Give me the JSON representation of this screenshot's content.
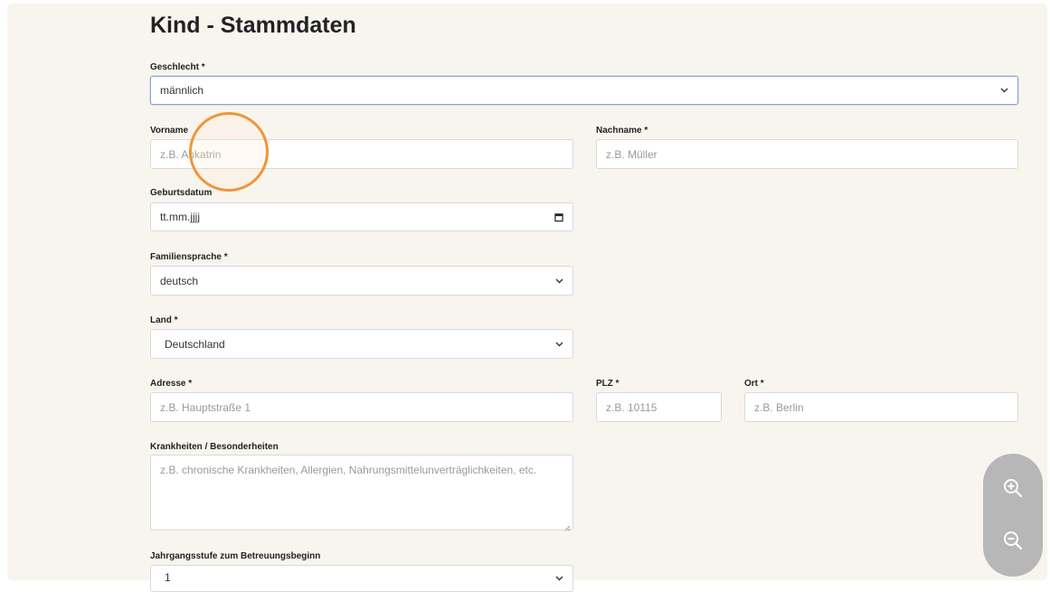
{
  "page_title": "Kind - Stammdaten",
  "fields": {
    "geschlecht": {
      "label": "Geschlecht *",
      "value": "männlich"
    },
    "vorname": {
      "label": "Vorname",
      "placeholder": "z.B. Ankatrin"
    },
    "nachname": {
      "label": "Nachname *",
      "placeholder": "z.B. Müller"
    },
    "geburtsdatum": {
      "label": "Geburtsdatum",
      "value": "tt.mm.jjjj"
    },
    "familiensprache": {
      "label": "Familiensprache *",
      "value": "deutsch"
    },
    "land": {
      "label": "Land *",
      "value": "Deutschland"
    },
    "adresse": {
      "label": "Adresse *",
      "placeholder": "z.B. Hauptstraße 1"
    },
    "plz": {
      "label": "PLZ *",
      "placeholder": "z.B. 10115"
    },
    "ort": {
      "label": "Ort *",
      "placeholder": "z.B. Berlin"
    },
    "krankheiten": {
      "label": "Krankheiten / Besonderheiten",
      "placeholder": "z.B. chronische Krankheiten, Allergien, Nahrungsmittelunverträglichkeiten, etc."
    },
    "jahrgangsstufe": {
      "label": "Jahrgangsstufe zum Betreuungsbeginn",
      "value": "1"
    }
  },
  "icons": {
    "select_arrow": "chevron-down-icon",
    "date_picker": "calendar-icon",
    "zoom_in": "zoom-in-icon",
    "zoom_out": "zoom-out-icon"
  },
  "colors": {
    "panel_bg": "#f8f5ef",
    "click_indicator": "#f0953a",
    "zoom_controls_bg": "#b7b7b7"
  }
}
